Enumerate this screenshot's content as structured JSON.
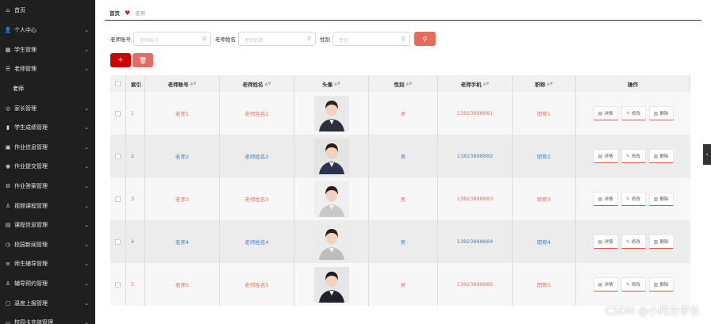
{
  "sidebar": {
    "items": [
      {
        "label": "首页",
        "icon": "home-icon",
        "chevron": false,
        "sub": false
      },
      {
        "label": "个人中心",
        "icon": "user-icon",
        "chevron": true,
        "sub": false
      },
      {
        "label": "学生管理",
        "icon": "grid-icon",
        "chevron": true,
        "sub": false
      },
      {
        "label": "老师管理",
        "icon": "list-icon",
        "chevron": true,
        "sub": false
      },
      {
        "label": "老师",
        "icon": "",
        "chevron": false,
        "sub": true
      },
      {
        "label": "家长管理",
        "icon": "compass-icon",
        "chevron": true,
        "sub": false
      },
      {
        "label": "学生成绩管理",
        "icon": "bar-chart-icon",
        "chevron": true,
        "sub": false
      },
      {
        "label": "作业信息管理",
        "icon": "briefcase-icon",
        "chevron": true,
        "sub": false
      },
      {
        "label": "作业提交管理",
        "icon": "target-icon",
        "chevron": true,
        "sub": false
      },
      {
        "label": "作业答案管理",
        "icon": "gear-icon",
        "chevron": true,
        "sub": false
      },
      {
        "label": "视频课程管理",
        "icon": "person-icon",
        "chevron": true,
        "sub": false
      },
      {
        "label": "课程信息管理",
        "icon": "box-icon",
        "chevron": true,
        "sub": false
      },
      {
        "label": "校园新闻管理",
        "icon": "clock-icon",
        "chevron": true,
        "sub": false
      },
      {
        "label": "师生辅导管理",
        "icon": "menu-icon",
        "chevron": true,
        "sub": false
      },
      {
        "label": "辅导预约管理",
        "icon": "person-icon",
        "chevron": true,
        "sub": false
      },
      {
        "label": "温度上报管理",
        "icon": "frame-icon",
        "chevron": true,
        "sub": false
      },
      {
        "label": "校园卡充值管理",
        "icon": "card-icon",
        "chevron": true,
        "sub": false
      }
    ]
  },
  "breadcrumb": {
    "home": "首页",
    "current": "老师"
  },
  "search": {
    "fields": [
      {
        "label": "老师账号",
        "placeholder": "老师账号"
      },
      {
        "label": "老师姓名",
        "placeholder": "老师姓名"
      },
      {
        "label": "性别",
        "placeholder": "性别"
      }
    ]
  },
  "table": {
    "headers": [
      "索引",
      "老师账号",
      "老师姓名",
      "头像",
      "性别",
      "老师手机",
      "职称",
      "操作"
    ],
    "rows": [
      {
        "idx": "1",
        "account": "老师1",
        "name": "老师姓名1",
        "sex": "男",
        "phone": "13823888881",
        "title": "职称1",
        "color": "red"
      },
      {
        "idx": "2",
        "account": "老师2",
        "name": "老师姓名2",
        "sex": "男",
        "phone": "13823888882",
        "title": "职称2",
        "color": "blue"
      },
      {
        "idx": "3",
        "account": "老师3",
        "name": "老师姓名3",
        "sex": "男",
        "phone": "13823888883",
        "title": "职称3",
        "color": "red"
      },
      {
        "idx": "4",
        "account": "老师4",
        "name": "老师姓名4",
        "sex": "男",
        "phone": "13823888884",
        "title": "职称4",
        "color": "blue"
      },
      {
        "idx": "5",
        "account": "老师5",
        "name": "老师姓名5",
        "sex": "男",
        "phone": "13823888885",
        "title": "职称5",
        "color": "red"
      }
    ],
    "ops": {
      "detail": "详情",
      "edit": "修改",
      "delete": "删除"
    }
  },
  "watermark": "CSDN @小阿杰学长",
  "colors": {
    "sidebar_bg": "#1f1f1f",
    "accent_red": "#cc0000",
    "text_red": "#e57368",
    "text_blue": "#4a86c5"
  }
}
